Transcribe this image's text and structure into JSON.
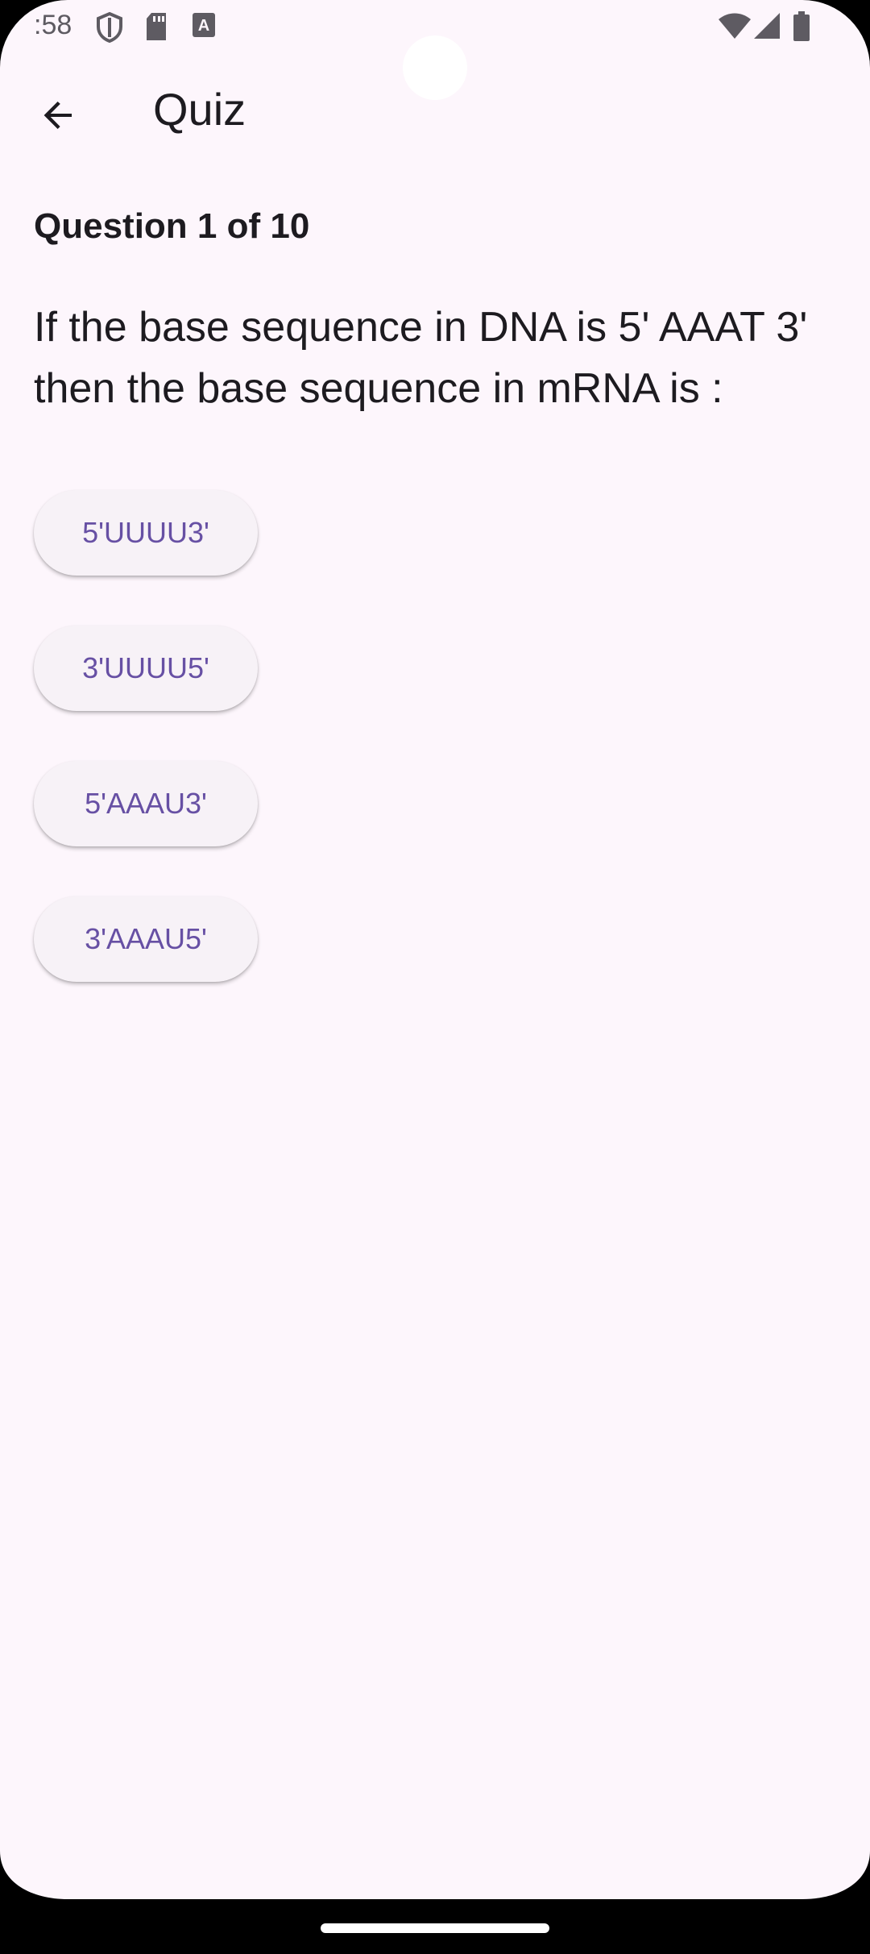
{
  "status_bar": {
    "time": ":58",
    "icons": [
      "shield-icon",
      "sd-card-icon",
      "text-a-icon",
      "wifi-icon",
      "signal-icon",
      "battery-icon"
    ]
  },
  "app_bar": {
    "back_icon": "arrow-back-icon",
    "title": "Quiz"
  },
  "quiz": {
    "counter": "Question 1 of 10",
    "question": "If the base sequence in DNA is 5' AAAT 3' then the base sequence in mRNA is :",
    "options": [
      "5'UUUU3'",
      "3'UUUU5'",
      "5'AAAU3'",
      "3'AAAU5'"
    ]
  },
  "colors": {
    "background": "#fdf6fc",
    "accent": "#6750a4",
    "text": "#1d1b20",
    "button_surface": "#f7f2f7"
  }
}
